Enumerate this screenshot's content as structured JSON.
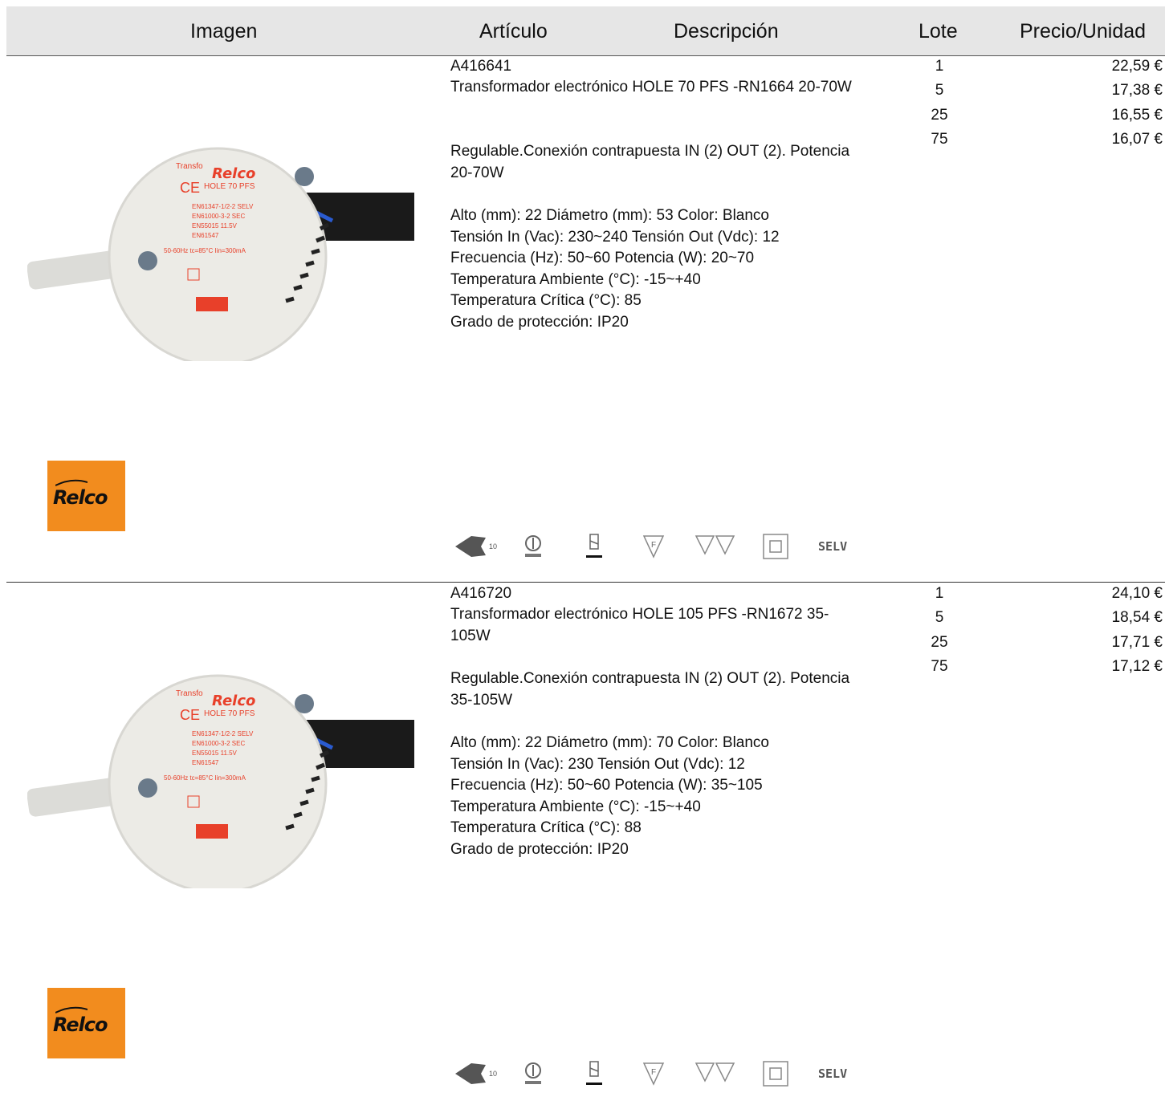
{
  "header": {
    "imagen": "Imagen",
    "articulo": "Artículo",
    "descripcion": "Descripción",
    "lote": "Lote",
    "precio": "Precio/Unidad"
  },
  "products": [
    {
      "code": "A416641",
      "title": "Transformador electrónico HOLE 70 PFS -RN1664 20-70W",
      "description": "Regulable.Conexión contrapuesta IN (2) OUT (2). Potencia 20-70W",
      "specs": [
        "Alto (mm): 22 Diámetro (mm): 53 Color: Blanco",
        "Tensión In (Vac): 230~240 Tensión Out (Vdc): 12",
        "Frecuencia (Hz): 50~60 Potencia (W): 20~70",
        "Temperatura Ambiente (°C): -15~+40",
        "Temperatura Crítica (°C): 85",
        "Grado de protección: IP20"
      ],
      "lots": [
        "1",
        "5",
        "25",
        "75"
      ],
      "prices": [
        "22,59 €",
        "17,38 €",
        "16,55 €",
        "16,07 €"
      ],
      "icons": [
        "enec-10-icon",
        "class-ii-transformer-icon",
        "short-circuit-proof-icon",
        "f-mark-icon",
        "mm-mark-icon",
        "double-insulation-icon"
      ],
      "selv": "SELV",
      "brand": "Relco"
    },
    {
      "code": "A416720",
      "title": "Transformador electrónico HOLE 105 PFS -RN1672 35-105W",
      "description": "Regulable.Conexión contrapuesta IN (2) OUT (2). Potencia 35-105W",
      "specs": [
        "Alto (mm): 22 Diámetro (mm): 70 Color: Blanco",
        "Tensión In (Vac): 230 Tensión Out (Vdc): 12",
        "Frecuencia (Hz): 50~60 Potencia (W): 35~105",
        "Temperatura Ambiente (°C): -15~+40",
        "Temperatura Crítica (°C): 88",
        "Grado de protección: IP20"
      ],
      "lots": [
        "1",
        "5",
        "25",
        "75"
      ],
      "prices": [
        "24,10 €",
        "18,54 €",
        "17,71 €",
        "17,12 €"
      ],
      "icons": [
        "enec-10-icon",
        "class-ii-transformer-icon",
        "short-circuit-proof-icon",
        "f-mark-icon",
        "mm-mark-icon",
        "double-insulation-icon"
      ],
      "selv": "SELV",
      "brand": "Relco"
    }
  ],
  "colors": {
    "header_bg": "#e6e6e6",
    "brand_orange": "#f28c1e",
    "label_red": "#e8402a"
  }
}
